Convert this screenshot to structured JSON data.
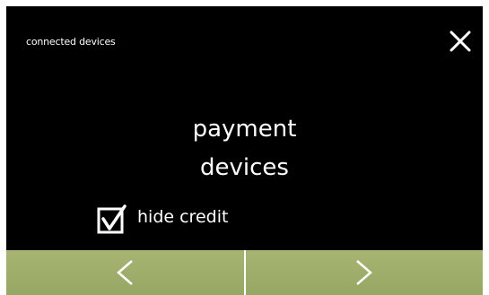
{
  "header": {
    "breadcrumb": "connected devices",
    "close_icon": "close-icon"
  },
  "main": {
    "title_line1": "payment",
    "title_line2": "devices",
    "hide_credit": {
      "label": "hide credit",
      "checked": true
    }
  },
  "footer": {
    "prev_icon": "chevron-left-icon",
    "next_icon": "chevron-right-icon"
  },
  "colors": {
    "background": "#000000",
    "text": "#ffffff",
    "nav_button": "#a2b06c"
  }
}
